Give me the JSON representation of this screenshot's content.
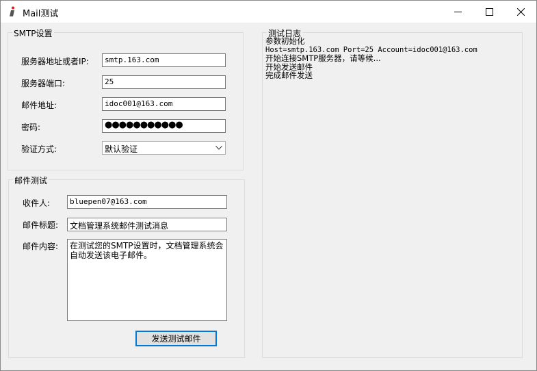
{
  "window": {
    "title": "Mail测试"
  },
  "smtp": {
    "legend": "SMTP设置",
    "server_label": "服务器地址或者IP:",
    "server_value": "smtp.163.com",
    "port_label": "服务器端口:",
    "port_value": "25",
    "email_label": "邮件地址:",
    "email_value": "idoc001@163.com",
    "password_label": "密码:",
    "password_value": "●●●●●●●●●●●",
    "auth_label": "验证方式:",
    "auth_value": "默认验证"
  },
  "mail": {
    "legend": "邮件测试",
    "to_label": "收件人:",
    "to_value": "bluepen07@163.com",
    "subject_label": "邮件标题:",
    "subject_value": "文档管理系统邮件测试消息",
    "body_label": "邮件内容:",
    "body_value": "在测试您的SMTP设置时，文档管理系统会自动发送该电子邮件。",
    "send_button": "发送测试邮件"
  },
  "log": {
    "legend": "测试日志",
    "lines": [
      "参数初始化",
      "Host=smtp.163.com Port=25 Account=idoc001@163.com",
      "开始连接SMTP服务器，请等候...",
      "开始发送邮件",
      "完成邮件发送"
    ]
  }
}
